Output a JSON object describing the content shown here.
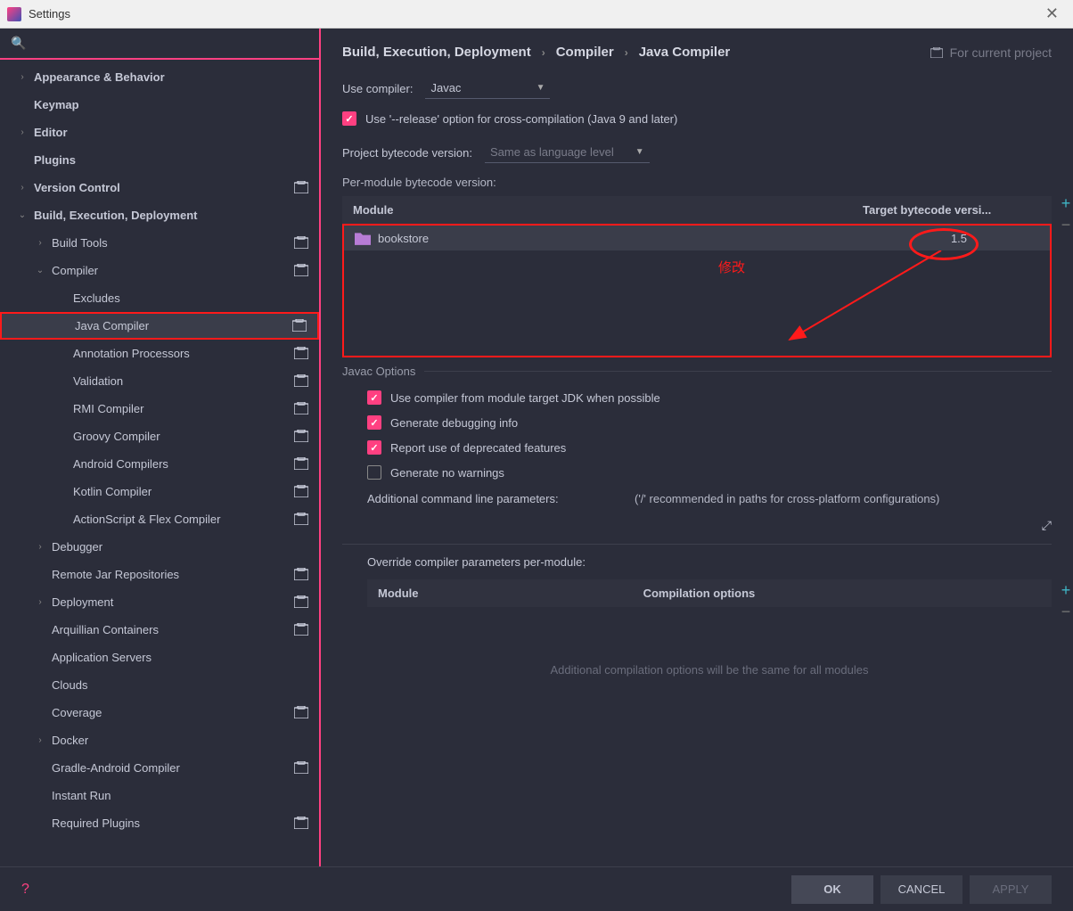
{
  "window": {
    "title": "Settings"
  },
  "sidebar": {
    "search_placeholder": "",
    "items": [
      {
        "label": "Appearance & Behavior",
        "level": 0,
        "bold": true,
        "chev": "›",
        "proj": false
      },
      {
        "label": "Keymap",
        "level": 0,
        "bold": true,
        "chev": "",
        "proj": false
      },
      {
        "label": "Editor",
        "level": 0,
        "bold": true,
        "chev": "›",
        "proj": false
      },
      {
        "label": "Plugins",
        "level": 0,
        "bold": true,
        "chev": "",
        "proj": false
      },
      {
        "label": "Version Control",
        "level": 0,
        "bold": true,
        "chev": "›",
        "proj": true
      },
      {
        "label": "Build, Execution, Deployment",
        "level": 0,
        "bold": true,
        "chev": "⌄",
        "proj": false
      },
      {
        "label": "Build Tools",
        "level": 1,
        "bold": false,
        "chev": "›",
        "proj": true
      },
      {
        "label": "Compiler",
        "level": 1,
        "bold": false,
        "chev": "⌄",
        "proj": true
      },
      {
        "label": "Excludes",
        "level": 2,
        "bold": false,
        "chev": "",
        "proj": false
      },
      {
        "label": "Java Compiler",
        "level": 2,
        "bold": false,
        "chev": "",
        "proj": true,
        "selected": true,
        "highlight": true
      },
      {
        "label": "Annotation Processors",
        "level": 2,
        "bold": false,
        "chev": "",
        "proj": true
      },
      {
        "label": "Validation",
        "level": 2,
        "bold": false,
        "chev": "",
        "proj": true
      },
      {
        "label": "RMI Compiler",
        "level": 2,
        "bold": false,
        "chev": "",
        "proj": true
      },
      {
        "label": "Groovy Compiler",
        "level": 2,
        "bold": false,
        "chev": "",
        "proj": true
      },
      {
        "label": "Android Compilers",
        "level": 2,
        "bold": false,
        "chev": "",
        "proj": true
      },
      {
        "label": "Kotlin Compiler",
        "level": 2,
        "bold": false,
        "chev": "",
        "proj": true
      },
      {
        "label": "ActionScript & Flex Compiler",
        "level": 2,
        "bold": false,
        "chev": "",
        "proj": true
      },
      {
        "label": "Debugger",
        "level": 1,
        "bold": false,
        "chev": "›",
        "proj": false
      },
      {
        "label": "Remote Jar Repositories",
        "level": 1,
        "bold": false,
        "chev": "",
        "proj": true
      },
      {
        "label": "Deployment",
        "level": 1,
        "bold": false,
        "chev": "›",
        "proj": true
      },
      {
        "label": "Arquillian Containers",
        "level": 1,
        "bold": false,
        "chev": "",
        "proj": true
      },
      {
        "label": "Application Servers",
        "level": 1,
        "bold": false,
        "chev": "",
        "proj": false
      },
      {
        "label": "Clouds",
        "level": 1,
        "bold": false,
        "chev": "",
        "proj": false
      },
      {
        "label": "Coverage",
        "level": 1,
        "bold": false,
        "chev": "",
        "proj": true
      },
      {
        "label": "Docker",
        "level": 1,
        "bold": false,
        "chev": "›",
        "proj": false
      },
      {
        "label": "Gradle-Android Compiler",
        "level": 1,
        "bold": false,
        "chev": "",
        "proj": true
      },
      {
        "label": "Instant Run",
        "level": 1,
        "bold": false,
        "chev": "",
        "proj": false
      },
      {
        "label": "Required Plugins",
        "level": 1,
        "bold": false,
        "chev": "",
        "proj": true
      }
    ]
  },
  "breadcrumb": {
    "parts": [
      "Build, Execution, Deployment",
      "Compiler",
      "Java Compiler"
    ],
    "scope": "For current project"
  },
  "compiler": {
    "use_compiler_label": "Use compiler:",
    "use_compiler_value": "Javac",
    "release_option": "Use '--release' option for cross-compilation (Java 9 and later)",
    "release_checked": true,
    "project_bytecode_label": "Project bytecode version:",
    "project_bytecode_value": "Same as language level",
    "per_module_label": "Per-module bytecode version:",
    "table": {
      "col_module": "Module",
      "col_target": "Target bytecode versi...",
      "rows": [
        {
          "name": "bookstore",
          "target": "1.5"
        }
      ]
    },
    "annotation": "修改"
  },
  "javac": {
    "legend": "Javac Options",
    "opt1": "Use compiler from module target JDK when possible",
    "opt2": "Generate debugging info",
    "opt3": "Report use of deprecated features",
    "opt4": "Generate no warnings",
    "params_label": "Additional command line parameters:",
    "params_hint": "('/' recommended in paths for cross-platform configurations)"
  },
  "override": {
    "label": "Override compiler parameters per-module:",
    "col_module": "Module",
    "col_options": "Compilation options",
    "placeholder": "Additional compilation options will be the same for all modules"
  },
  "footer": {
    "ok": "OK",
    "cancel": "CANCEL",
    "apply": "APPLY"
  }
}
